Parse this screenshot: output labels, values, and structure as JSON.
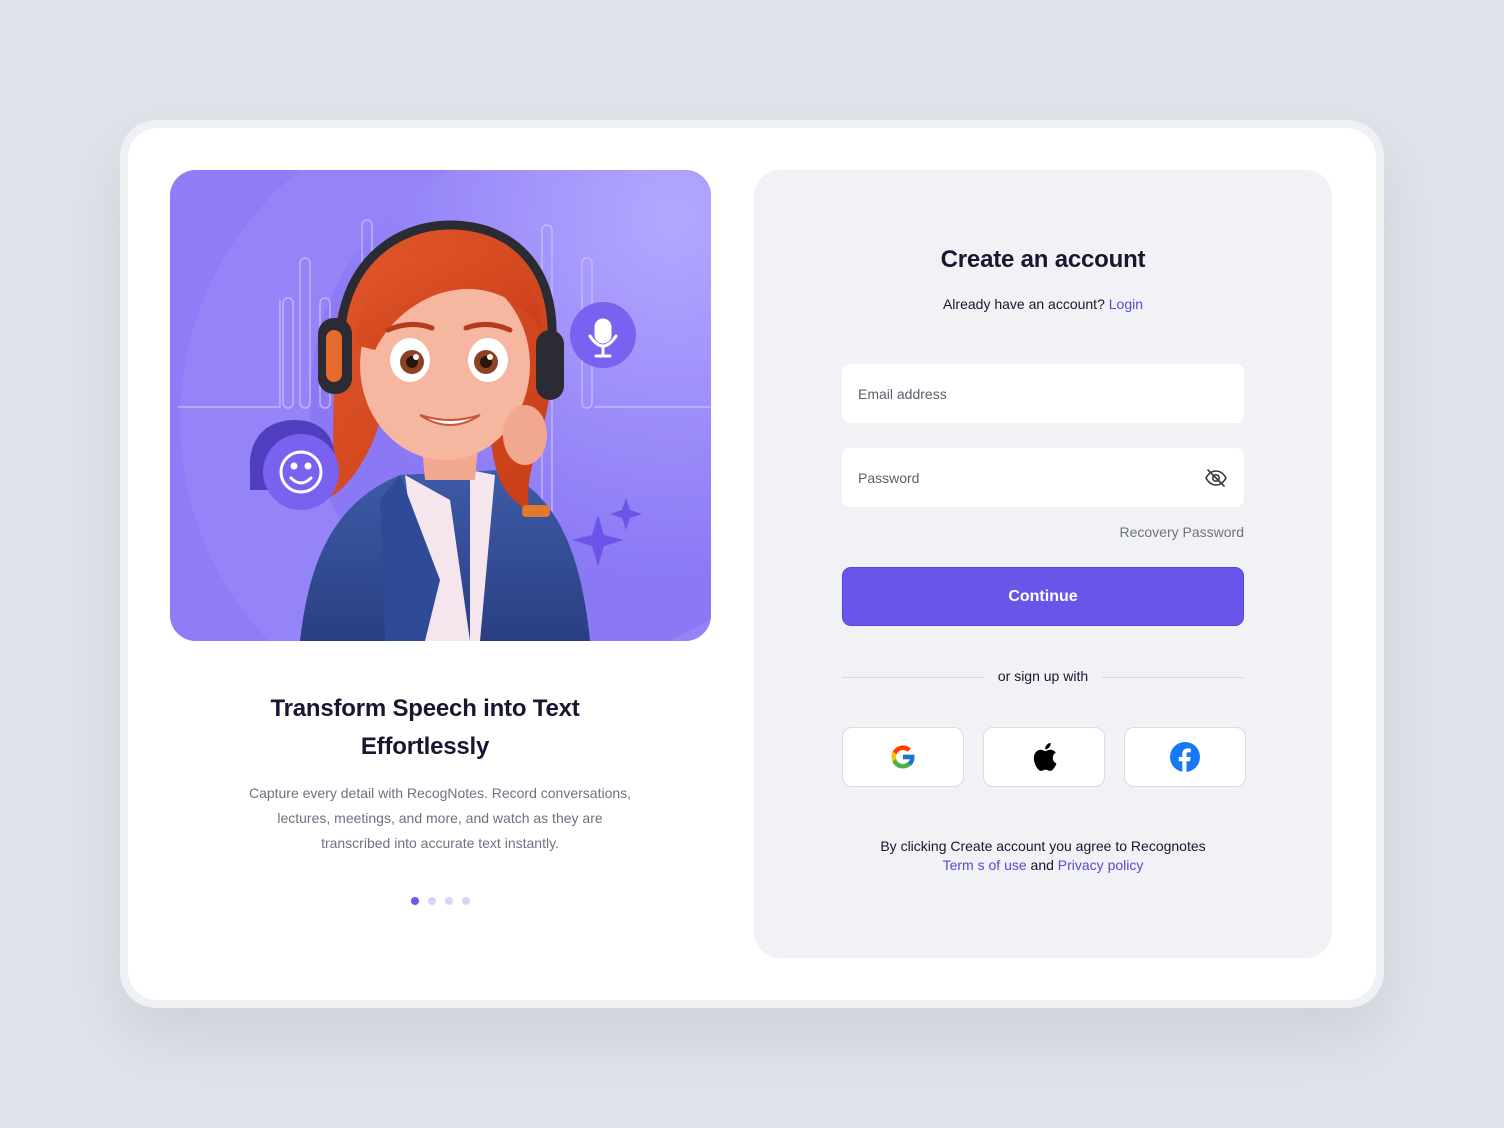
{
  "hero": {
    "illustration": "3d-woman-with-headset",
    "accent_color": "#8e7cf8",
    "badges": [
      "microphone-icon",
      "smiley-chat-icon",
      "sparkle-icon"
    ]
  },
  "slide": {
    "title_line1": "Transform Speech into Text",
    "title_line2": "Effortlessly",
    "description_line1": "Capture every detail with RecogNotes. Record conversations,",
    "description_line2": "lectures, meetings, and more, and watch as they are",
    "description_line3": "transcribed into accurate text instantly.",
    "dots_total": 4,
    "dots_active": 1
  },
  "form": {
    "title": "Create an account",
    "login_prompt": "Already have an account?",
    "login_link": "Login",
    "email_placeholder": "Email address",
    "password_placeholder": "Password",
    "recovery_link": "Recovery Password",
    "continue_label": "Continue",
    "divider_text": "or sign up with",
    "social": [
      "google-icon",
      "apple-icon",
      "facebook-icon"
    ],
    "terms_prefix": "By clicking Create account you agree to Recognotes",
    "terms_link": "Term s of use",
    "terms_and": "and",
    "privacy_link": "Privacy policy"
  },
  "colors": {
    "primary": "#6a55ea",
    "link": "#5a48d6",
    "panel_bg": "#f1f2f6",
    "page_bg": "#dfe3ea"
  }
}
